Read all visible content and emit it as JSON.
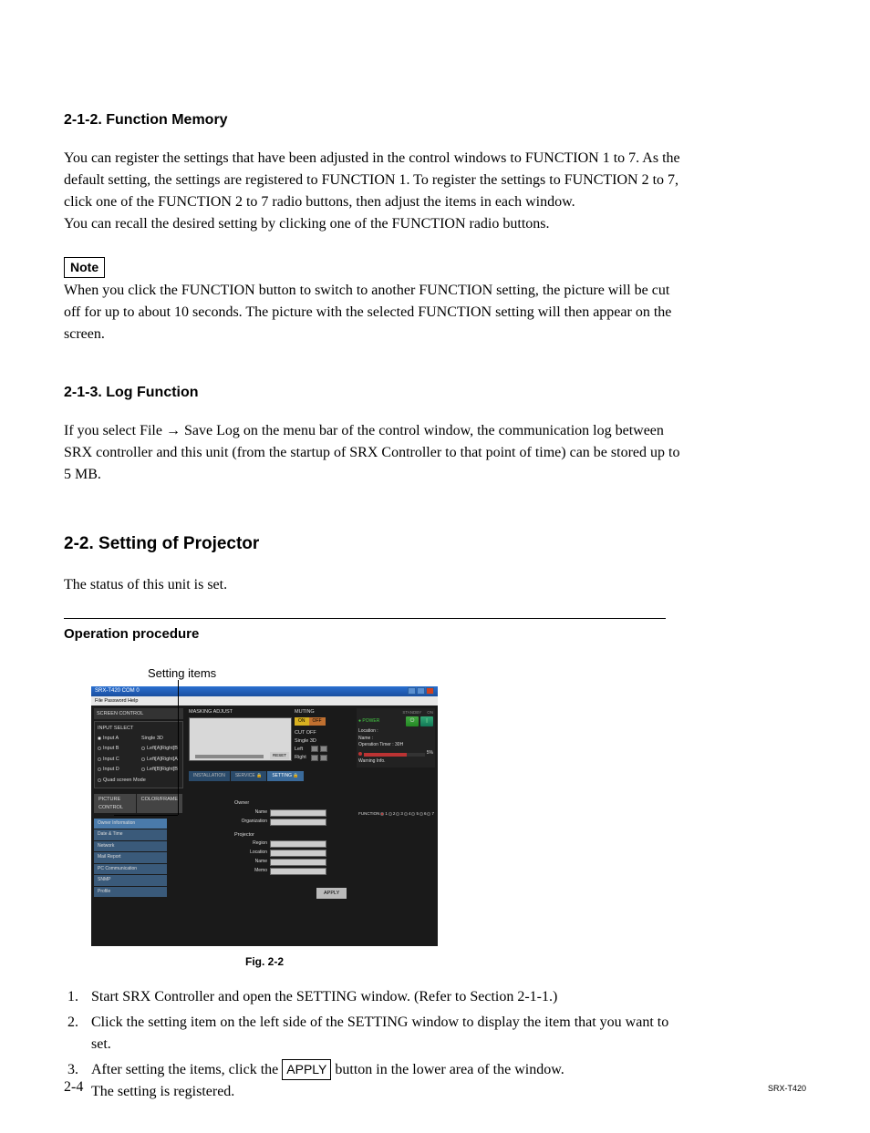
{
  "s212": {
    "heading": "2-1-2.  Function Memory",
    "p1": "You can register the settings that have been adjusted in the control windows to FUNCTION 1 to 7. As the default setting, the settings are registered to FUNCTION 1. To register the settings to FUNCTION 2 to 7, click one of the FUNCTION 2 to 7 radio buttons, then adjust the items in each window.",
    "p2": "You can recall the desired setting by clicking one of the FUNCTION radio buttons.",
    "note_label": "Note",
    "note_body": "When you click the FUNCTION button to switch to another FUNCTION setting, the picture will be cut off for up to about 10 seconds. The picture with the selected FUNCTION setting will then appear on the screen."
  },
  "s213": {
    "heading": "2-1-3.  Log Function",
    "p1": "If you select File → Save Log on the menu bar of the control window, the communication log between SRX controller and this unit (from the startup of SRX Controller to that point of time) can be stored up to 5 MB."
  },
  "s22": {
    "heading": "2-2.   Setting of Projector",
    "p1": "The status of this unit is set.",
    "subhead": "Operation procedure",
    "setting_items_label": "Setting items",
    "fig_caption": "Fig. 2-2"
  },
  "screenshot": {
    "title": "SRX-T420 COM 0",
    "menu": "File   Password   Help",
    "screen_control": "SCREEN CONTROL",
    "input_select": "INPUT SELECT",
    "inputs": [
      "Input A",
      "Input B",
      "Input C",
      "Input D"
    ],
    "modes": [
      "Single 3D",
      "Left[A]Right[B]",
      "Left[A]Right[A]",
      "Left[B]Right[B]"
    ],
    "quad": "Quad screen Mode",
    "mask": "MASKING ADJUST",
    "mask_reset": "RESET",
    "muting": "MUTING",
    "mute_on": "ON",
    "mute_off": "OFF",
    "cutoff": "CUT OFF",
    "cutoff_single": "Single 3D",
    "cutoff_left": "Left",
    "cutoff_right": "Right",
    "power_label": "POWER",
    "standby": "STANDBY",
    "on": "ON",
    "loc_l": "Location :",
    "name_l": "Name :",
    "optimer": "Operation Timer : 30H",
    "lamp_pct": "5%",
    "warn": "Warning Info.",
    "tabs_left": [
      "PICTURE CONTROL",
      "COLOR/FRAME"
    ],
    "tabs_right": [
      "INSTALLATION",
      "SERVICE",
      "SETTING"
    ],
    "function": "FUNCTION",
    "side_items": [
      "Owner Information",
      "Date & Time",
      "Network",
      "Mail Report",
      "PC Communication",
      "SNMP",
      "Profile"
    ],
    "owner": "Owner",
    "form_name": "Name",
    "form_org": "Organization",
    "projector": "Projector",
    "form_region": "Region",
    "form_location": "Location",
    "form_name2": "Name",
    "form_memo": "Memo",
    "apply": "APPLY"
  },
  "steps": {
    "s1": "Start SRX Controller and open the SETTING window. (Refer to Section 2-1-1.)",
    "s2": "Click the setting item on the left side of the SETTING window to display the item that you want to set.",
    "s3a": "After setting the items, click the ",
    "s3_apply": "APPLY",
    "s3b": " button in the lower area of the window.",
    "s3c": "The setting is registered."
  },
  "footer": {
    "page": "2-4",
    "model": "SRX-T420"
  }
}
